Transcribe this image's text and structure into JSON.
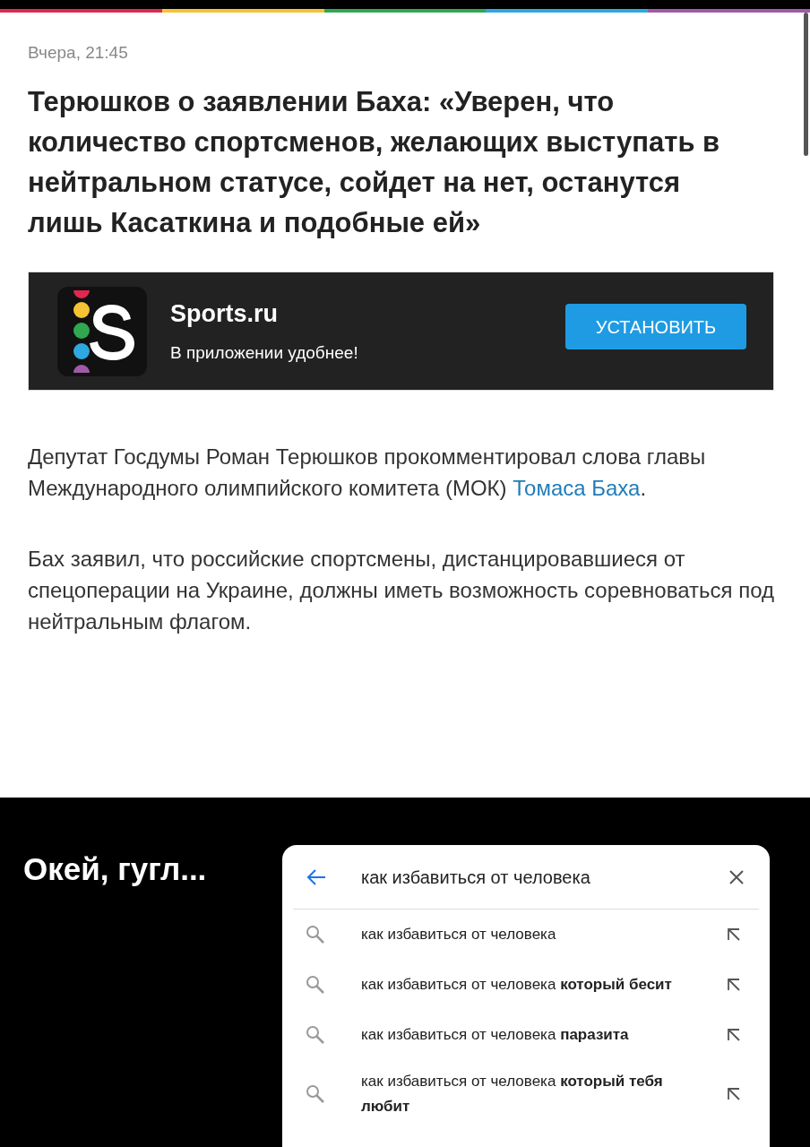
{
  "article": {
    "date": "Вчера, 21:45",
    "title": "Терюшков о заявлении Баха: «Уверен, что количество спортсменов, желающих выступать в нейтральном статусе, сойдет на нет, останутся лишь Касаткина и подобные ей»",
    "app_banner": {
      "name": "Sports.ru",
      "tagline": "В приложении удобнее!",
      "button": "УСТАНОВИТЬ"
    },
    "paragraphs": [
      {
        "text_before": "Депутат Госдумы Роман Терюшков прокомментировал слова главы Международного олимпийского комитета (МОК) ",
        "link": "Томаса Баха",
        "text_after": "."
      },
      {
        "text_before": "Бах заявил, что российские спортсмены, дистанцировавшиеся от спецоперации на Украине, должны иметь возможность соревноваться под нейтральным флагом."
      }
    ]
  },
  "caption": "Окей, гугл...",
  "search": {
    "query": "как избавиться от человека",
    "suggestions": [
      "как избавиться от человека",
      "как избавиться от человека **который бесит**",
      "как избавиться от человека **паразита**",
      "как избавиться от человека **который тебя любит**"
    ]
  }
}
